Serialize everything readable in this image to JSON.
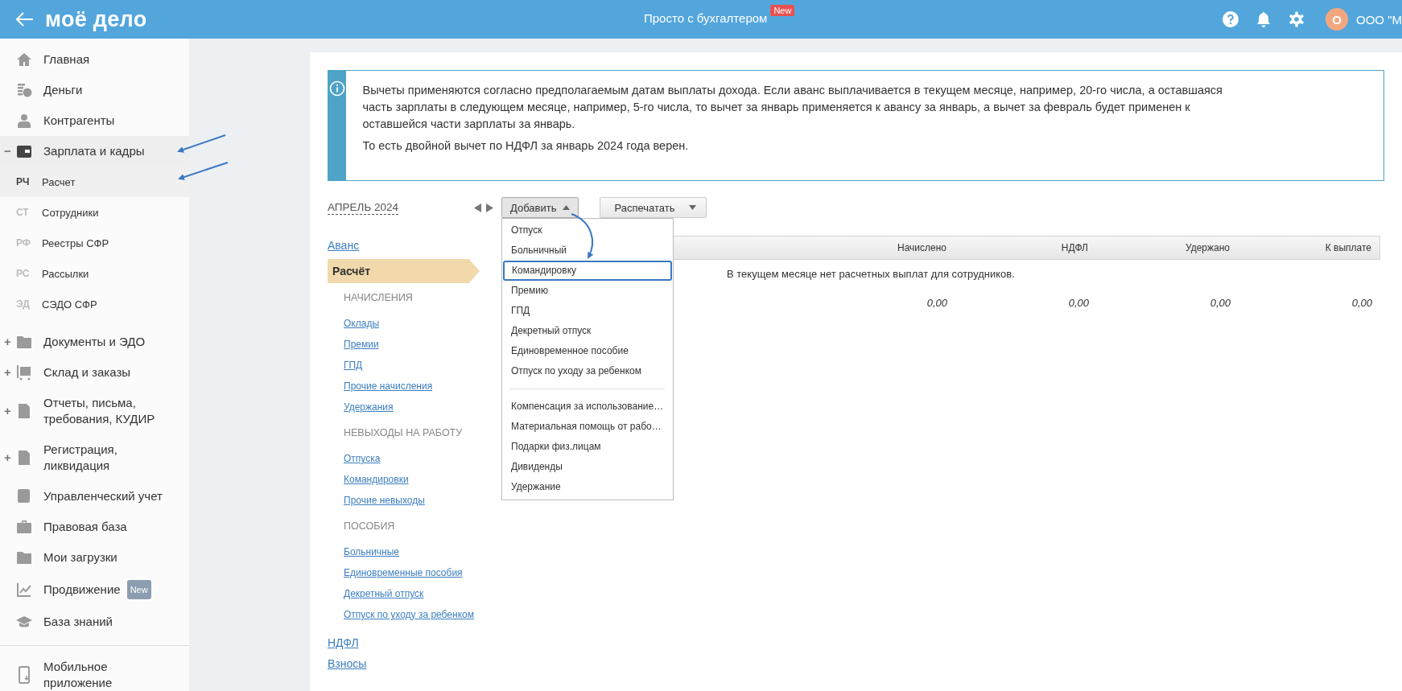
{
  "header": {
    "logo": "моё дело",
    "center_title": "Просто с бухгалтером",
    "center_badge": "New",
    "avatar_letter": "О",
    "org_name": "ООО \"М"
  },
  "sidebar": {
    "items": [
      {
        "label": "Главная",
        "selected": false
      },
      {
        "label": "Деньги",
        "selected": false
      },
      {
        "label": "Контрагенты",
        "selected": false
      },
      {
        "label": "Зарплата и кадры",
        "toggle": "−",
        "selected": true,
        "children": [
          {
            "abbr": "РЧ",
            "label": "Расчет",
            "selected": true
          },
          {
            "abbr": "СТ",
            "label": "Сотрудники",
            "selected": false
          },
          {
            "abbr": "РФ",
            "label": "Реестры СФР",
            "selected": false
          },
          {
            "abbr": "РС",
            "label": "Рассылки",
            "selected": false
          },
          {
            "abbr": "ЭД",
            "label": "СЭДО СФР",
            "selected": false
          }
        ]
      },
      {
        "label": "Документы и ЭДО",
        "toggle": "+",
        "selected": false
      },
      {
        "label": "Склад и заказы",
        "toggle": "+",
        "selected": false
      },
      {
        "label": "Отчеты, письма, требования, КУДИР",
        "toggle": "+",
        "selected": false
      },
      {
        "label": "Регистрация, ликвидация",
        "toggle": "+",
        "selected": false
      },
      {
        "label": "Управленческий учет",
        "selected": false
      },
      {
        "label": "Правовая база",
        "selected": false
      },
      {
        "label": "Мои загрузки",
        "selected": false
      },
      {
        "label": "Продвижение",
        "badge": "New",
        "selected": false
      },
      {
        "label": "База знаний",
        "selected": false
      }
    ],
    "footer": {
      "label": "Мобильное приложение"
    }
  },
  "info": {
    "paragraphs": [
      "Вычеты применяются согласно предполагаемым датам выплаты дохода. Если аванс выплачивается в текущем месяце, например, 20-го числа, а оставшаяся часть зарплаты в следующем месяце, например, 5-го числа, то вычет за январь применяется к авансу за январь, а вычет за февраль будет применен к оставшейся части зарплаты за январь.",
      "То есть двойной вычет по НДФЛ за январь 2024 года верен."
    ]
  },
  "period": {
    "label": "АПРЕЛЬ 2024"
  },
  "left_nav": [
    {
      "kind": "link",
      "label": "Аванс"
    },
    {
      "kind": "active",
      "label": "Расчёт"
    },
    {
      "kind": "heading",
      "label": "НАЧИСЛЕНИЯ"
    },
    {
      "kind": "sublink",
      "label": "Оклады"
    },
    {
      "kind": "sublink",
      "label": "Премии"
    },
    {
      "kind": "sublink",
      "label": "ГПД"
    },
    {
      "kind": "sublink",
      "label": "Прочие начисления"
    },
    {
      "kind": "sublink",
      "label": "Удержания"
    },
    {
      "kind": "heading",
      "label": "НЕВЫХОДЫ НА РАБОТУ"
    },
    {
      "kind": "sublink",
      "label": "Отпуска"
    },
    {
      "kind": "sublink",
      "label": "Командировки"
    },
    {
      "kind": "sublink",
      "label": "Прочие невыходы"
    },
    {
      "kind": "heading",
      "label": "ПОСОБИЯ"
    },
    {
      "kind": "sublink",
      "label": "Больничные"
    },
    {
      "kind": "sublink",
      "label": "Единовременные пособия"
    },
    {
      "kind": "sublink",
      "label": "Декретный отпуск"
    },
    {
      "kind": "sublink",
      "label": "Отпуск по уходу за ребенком"
    },
    {
      "kind": "link",
      "label": "НДФЛ"
    },
    {
      "kind": "link",
      "label": "Взносы"
    }
  ],
  "toolbar": {
    "add_button": {
      "label": "Добавить",
      "expanded": true
    },
    "print_button": {
      "label": "Распечатать"
    }
  },
  "add_menu": {
    "groups": [
      [
        {
          "label": "Отпуск",
          "selected": false
        },
        {
          "label": "Больничный",
          "selected": false
        },
        {
          "label": "Командировку",
          "selected": true
        },
        {
          "label": "Премию",
          "selected": false
        },
        {
          "label": "ГПД",
          "selected": false
        },
        {
          "label": "Декретный отпуск",
          "selected": false
        },
        {
          "label": "Единовременное пособие",
          "selected": false
        },
        {
          "label": "Отпуск по уходу за ребенком",
          "selected": false
        }
      ],
      [
        {
          "label": "Компенсация за использование…",
          "selected": false
        },
        {
          "label": "Материальная помощь от рабо…",
          "selected": false
        },
        {
          "label": "Подарки физ.лицам",
          "selected": false
        },
        {
          "label": "Дивиденды",
          "selected": false
        },
        {
          "label": "Удержание",
          "selected": false
        }
      ]
    ]
  },
  "table": {
    "columns": [
      "Начислено",
      "НДФЛ",
      "Удержано",
      "К выплате"
    ],
    "empty_message": "В текущем месяце нет расчетных выплат для сотрудников.",
    "totals": [
      "0,00",
      "0,00",
      "0,00",
      "0,00"
    ]
  }
}
